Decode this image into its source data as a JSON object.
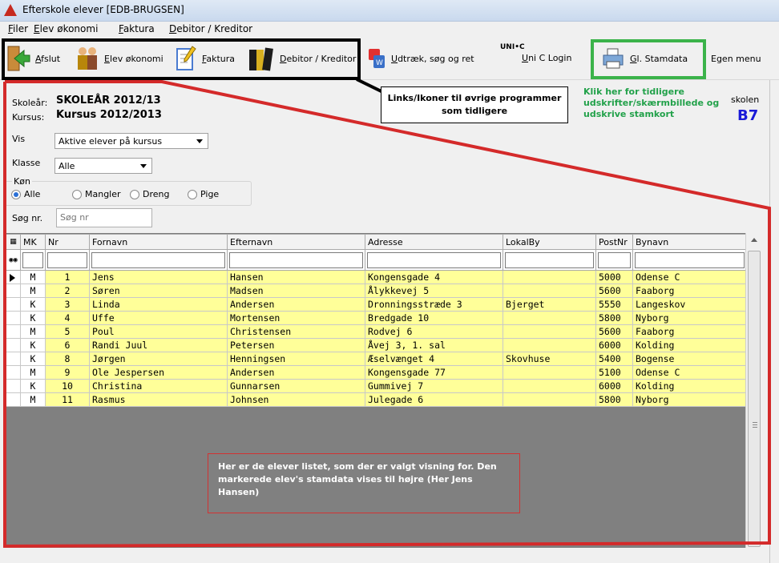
{
  "window": {
    "title": "Efterskole elever [EDB-BRUGSEN]"
  },
  "menu": [
    "Filer",
    "Elev økonomi",
    "Faktura",
    "Debitor / Kreditor"
  ],
  "toolbar": {
    "afslut": "Afslut",
    "elev_okonomi": "Elev økonomi",
    "faktura": "Faktura",
    "debitor": "Debitor / Kreditor",
    "udtraek": "Udtræk, søg og ret",
    "unic_logo": "UNI•C",
    "unic_login": "Uni C Login",
    "stamdata": "Gl. Stamdata",
    "egen_menu": "Egen menu"
  },
  "annotations": {
    "links": "Links/Ikoner til øvrige programmer som tidligere",
    "green": "Klik her for tidligere udskrifter/skærmbillede og udskrive stamkort",
    "red": "Her er de elever listet, som der er valgt visning for. Den markerede elev's stamdata vises til højre (Her Jens Hansen)"
  },
  "info": {
    "skolear_label": "Skoleår:",
    "skolear_value": "SKOLEÅR 2012/13",
    "kursus_label": "Kursus:",
    "kursus_value": "Kursus 2012/2013",
    "skolen_label": "skolen",
    "code": "B7"
  },
  "filters": {
    "vis_label": "Vis",
    "vis_value": "Aktive elever på kursus",
    "klasse_label": "Klasse",
    "klasse_value": "Alle",
    "kon_label": "Køn",
    "kon_options": [
      "Alle",
      "Mangler",
      "Dreng",
      "Pige"
    ],
    "kon_selected": "Alle",
    "sog_label": "Søg nr.",
    "sog_placeholder": "Søg nr"
  },
  "grid": {
    "columns": [
      "MK",
      "Nr",
      "Fornavn",
      "Efternavn",
      "Adresse",
      "LokalBy",
      "PostNr",
      "Bynavn"
    ],
    "selected_row": 0,
    "rows": [
      [
        "M",
        "1",
        "Jens",
        "Hansen",
        "Kongensgade 4",
        "",
        "5000",
        "Odense C"
      ],
      [
        "M",
        "2",
        "Søren",
        "Madsen",
        "Ålykkevej 5",
        "",
        "5600",
        "Faaborg"
      ],
      [
        "K",
        "3",
        "Linda",
        "Andersen",
        "Dronningsstræde 3",
        "Bjerget",
        "5550",
        "Langeskov"
      ],
      [
        "K",
        "4",
        "Uffe",
        "Mortensen",
        "Bredgade 10",
        "",
        "5800",
        "Nyborg"
      ],
      [
        "M",
        "5",
        "Poul",
        "Christensen",
        "Rodvej 6",
        "",
        "5600",
        "Faaborg"
      ],
      [
        "K",
        "6",
        "Randi Juul",
        "Petersen",
        "Åvej 3, 1. sal",
        "",
        "6000",
        "Kolding"
      ],
      [
        "K",
        "8",
        "Jørgen",
        "Henningsen",
        "Æselvænget 4",
        "Skovhuse",
        "5400",
        "Bogense"
      ],
      [
        "M",
        "9",
        "Ole Jespersen",
        "Andersen",
        "Kongensgade 77",
        "",
        "5100",
        "Odense C"
      ],
      [
        "K",
        "10",
        "Christina",
        "Gunnarsen",
        "Gummivej 7",
        "",
        "6000",
        "Kolding"
      ],
      [
        "M",
        "11",
        "Rasmus",
        "Johnsen",
        "Julegade 6",
        "",
        "5800",
        "Nyborg"
      ]
    ]
  }
}
